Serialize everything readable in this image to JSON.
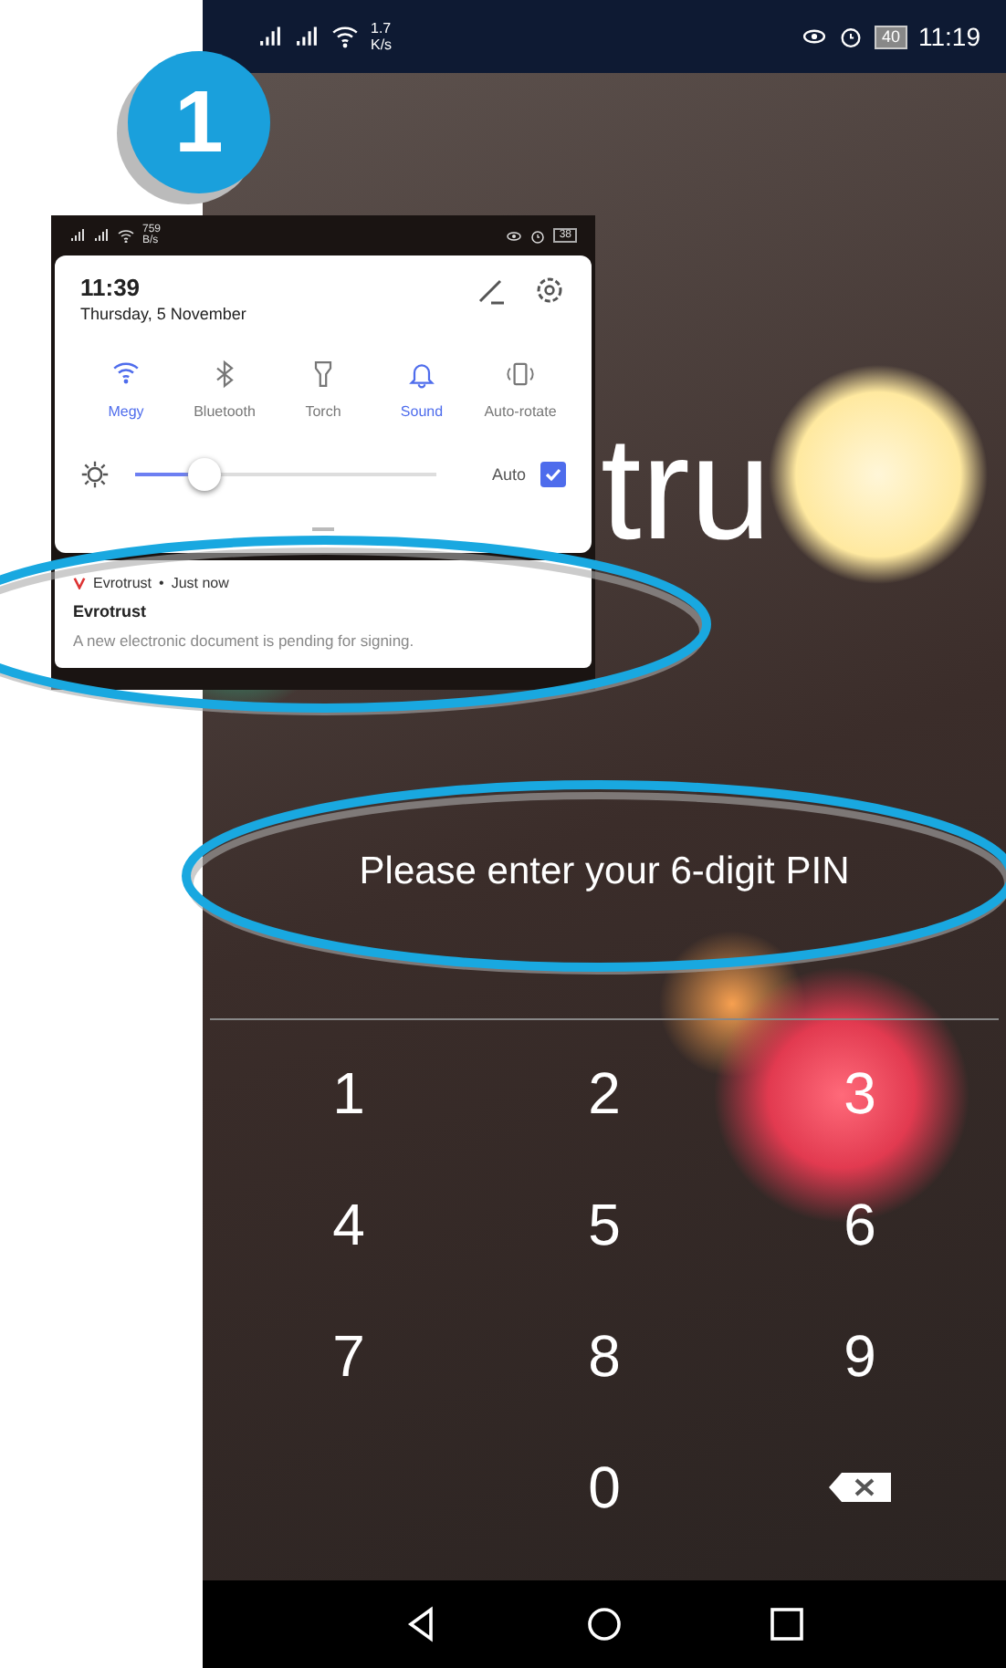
{
  "step_badge": {
    "label": "1"
  },
  "phone": {
    "status_bar": {
      "speed": "1.7",
      "speed_unit": "K/s",
      "battery": "40",
      "time": "11:19"
    },
    "logo_fragment": "tru",
    "prompt": "Please enter your 6-digit PIN",
    "keypad": [
      {
        "kind": "digit",
        "label": "1"
      },
      {
        "kind": "digit",
        "label": "2"
      },
      {
        "kind": "digit",
        "label": "3"
      },
      {
        "kind": "digit",
        "label": "4"
      },
      {
        "kind": "digit",
        "label": "5"
      },
      {
        "kind": "digit",
        "label": "6"
      },
      {
        "kind": "digit",
        "label": "7"
      },
      {
        "kind": "digit",
        "label": "8"
      },
      {
        "kind": "digit",
        "label": "9"
      },
      {
        "kind": "blank"
      },
      {
        "kind": "digit",
        "label": "0"
      },
      {
        "kind": "backspace"
      }
    ],
    "nav_buttons": [
      {
        "kind": "back"
      },
      {
        "kind": "home"
      },
      {
        "kind": "recent"
      }
    ]
  },
  "inset": {
    "status_bar": {
      "speed": "759",
      "speed_unit": "B/s",
      "battery": "38"
    },
    "time": "11:39",
    "date": "Thursday, 5 November",
    "toggles": [
      {
        "kind": "wifi",
        "label": "Megy",
        "on": true
      },
      {
        "kind": "bluetooth",
        "label": "Bluetooth",
        "on": false
      },
      {
        "kind": "torch",
        "label": "Torch",
        "on": false
      },
      {
        "kind": "sound",
        "label": "Sound",
        "on": true
      },
      {
        "kind": "rotate",
        "label": "Auto-rotate",
        "on": false
      }
    ],
    "brightness": {
      "level": 0.23
    },
    "auto": {
      "label": "Auto",
      "checked": true
    },
    "notification": {
      "app": "Evrotrust",
      "separator": "•",
      "when": "Just now",
      "title": "Evrotrust",
      "body": "A new electronic document is pending for signing."
    }
  }
}
